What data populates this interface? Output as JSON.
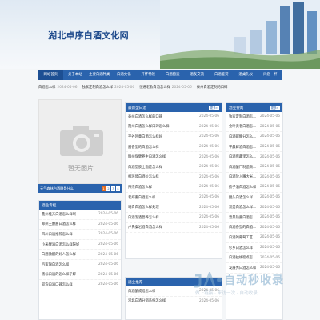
{
  "site": {
    "title": "湖北卓序白酒文化网"
  },
  "nav": [
    "网站首页",
    "关于本站",
    "主要白酒种类",
    "白酒文化",
    "开怀畅饮",
    "白酒酿造",
    "酒友交流",
    "白酒鉴赏",
    "酒桌礼仪",
    "问您一杯"
  ],
  "ticker": [
    {
      "title": "白酒怎么样",
      "date": "2024-05-06"
    },
    {
      "title": "独家定制白酒怎么样",
      "date": "2024-05-06"
    },
    {
      "title": "恒通老散白酒怎么样",
      "date": "2024-05-06"
    },
    {
      "title": "泰州白酒定制的口碑",
      "date": ""
    }
  ],
  "photo": {
    "no_image_text": "暂无图片",
    "caption": "元气森林白酒醋是什么",
    "pages": [
      "1",
      "2",
      "3",
      "4"
    ]
  },
  "left_box": {
    "title": "酒业专栏",
    "items": [
      {
        "t": "衢州桂方白酒怎么样啊",
        "d": "2024-05-06"
      },
      {
        "t": "郑州王爵酱白酒怎么样",
        "d": "2024-05-06"
      },
      {
        "t": "四川白酒推荐怎么样",
        "d": "2024-05-06"
      },
      {
        "t": "小米醒酒白酒怎么样呀好",
        "d": "2024-05-06"
      },
      {
        "t": "白酒微醺的好人怎么样",
        "d": "2024-05-06"
      },
      {
        "t": "百家旗白酒怎么样",
        "d": "2024-05-06"
      },
      {
        "t": "黑标白酒的怎么样了解",
        "d": "2024-05-06"
      },
      {
        "t": "双沟白酒口碑怎么样",
        "d": "2024-05-06"
      }
    ]
  },
  "mid_box": {
    "title": "最新型白酒",
    "more": "更多»",
    "items": [
      {
        "t": "泰州白酒怎么样的口碑",
        "d": "2024-05-06"
      },
      {
        "t": "荆州白酒怎么样口碑怎么样",
        "d": "2024-05-06"
      },
      {
        "t": "平谷区童白酒怎么样好",
        "d": "2024-05-06"
      },
      {
        "t": "酱香型的白酒怎么样",
        "d": "2024-05-06"
      },
      {
        "t": "酿州保健养生白酒怎么样",
        "d": "2024-05-06"
      },
      {
        "t": "白酒塑胶上面是怎么样",
        "d": "2024-05-06"
      },
      {
        "t": "根环境白酒价怎么样",
        "d": "2024-05-06"
      },
      {
        "t": "拜杰白酒怎么样",
        "d": "2024-05-06"
      },
      {
        "t": "老郑重白酒怎么样",
        "d": "2024-05-06"
      },
      {
        "t": "噶白白酒怎么样处理",
        "d": "2024-05-06"
      },
      {
        "t": "白酒泡酒营养怎么样",
        "d": "2024-05-06"
      },
      {
        "t": "卢氏秦岩酒白酒怎么样",
        "d": "2024-05-06"
      }
    ]
  },
  "mid_box2": {
    "title": "酒业推荐",
    "items": [
      {
        "t": "白酒酿成唱怎么样",
        "d": "2024-05-06"
      },
      {
        "t": "河北白酒分销系统怎么样",
        "d": "2024-05-06"
      }
    ]
  },
  "right_box": {
    "title": "酒业要闻",
    "more": "更多»",
    "items": [
      {
        "t": "独家定制白酒怎么样",
        "d": "2024-05-06"
      },
      {
        "t": "金叶黄者白酒怎么样",
        "d": "2024-05-06"
      },
      {
        "t": "白酒碳酸分怎么样不能喝",
        "d": "2024-05-06"
      },
      {
        "t": "宇晨鲜酒白酒怎么样",
        "d": "2024-05-06"
      },
      {
        "t": "白酒窖藏里怎么样的好喝",
        "d": "2024-05-06"
      },
      {
        "t": "白酒酿厂制造商条件怎么样",
        "d": "2024-05-06"
      },
      {
        "t": "白酒放入嘴大米怎么样",
        "d": "2024-05-06"
      },
      {
        "t": "挎子酒白酒怎么样",
        "d": "2024-05-06"
      },
      {
        "t": "醒头白酒怎么样",
        "d": "2024-05-06"
      },
      {
        "t": "双美白酒怎么样好喝",
        "d": "2024-05-06"
      },
      {
        "t": "营景热酱白酒怎么样",
        "d": "2024-05-06"
      },
      {
        "t": "白酒香型的白酒怎么样",
        "d": "2024-05-06"
      },
      {
        "t": "白酒的葡萄工艺怎么样",
        "d": "2024-05-06"
      },
      {
        "t": "杉乡白酒怎么样",
        "d": "2024-05-06"
      },
      {
        "t": "白酒拉线检点怎么样",
        "d": "2024-05-06"
      },
      {
        "t": "发展秀白酒怎么样",
        "d": "2024-05-06"
      }
    ]
  },
  "watermark": {
    "text": "自动秒收录",
    "sub": "做上链接 · 来访一次 · 自动收录"
  }
}
